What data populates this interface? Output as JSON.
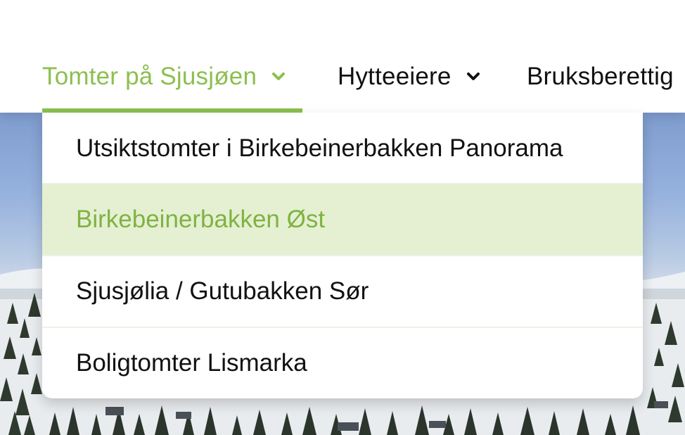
{
  "nav": {
    "items": [
      {
        "label": "Tomter på Sjusjøen",
        "active": true,
        "has_dropdown": true
      },
      {
        "label": "Hytteeiere",
        "active": false,
        "has_dropdown": true
      },
      {
        "label": "Bruksberettig",
        "active": false,
        "has_dropdown": false
      }
    ]
  },
  "dropdown": {
    "items": [
      {
        "label": "Utsiktstomter i Birkebeinerbakken Panorama"
      },
      {
        "label": "Birkebeinerbakken Øst",
        "hovered": true
      },
      {
        "label": "Sjusjølia / Gutubakken Sør"
      },
      {
        "label": "Boligtomter Lismarka"
      }
    ]
  },
  "colors": {
    "accent": "#8cbf4f",
    "hover_bg": "#e5f0d3",
    "text": "#111111"
  },
  "icons": {
    "dropdown_indicator": "chevron-down-icon"
  }
}
